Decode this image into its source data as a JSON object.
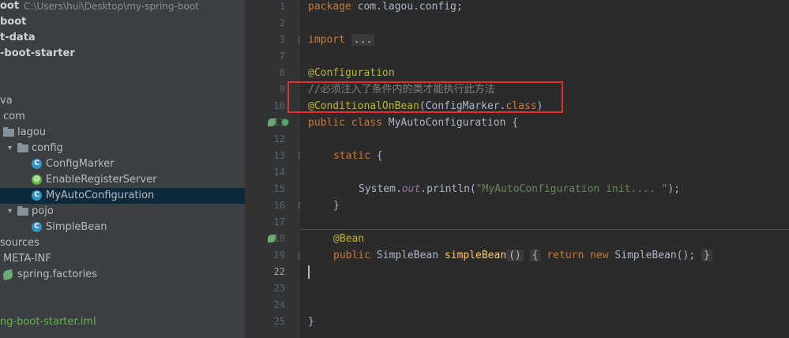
{
  "project_tree": [
    {
      "name": "tree-root-project",
      "label": "oot",
      "extra": "C:\\Users\\hui\\Desktop\\my-spring-boot",
      "style": "bold",
      "icon": "none"
    },
    {
      "name": "tree-module-boot",
      "label": "boot",
      "style": "bold",
      "icon": "none"
    },
    {
      "name": "tree-module-data",
      "label": "t-data",
      "style": "bold",
      "icon": "none"
    },
    {
      "name": "tree-module-starter",
      "label": "-boot-starter",
      "style": "bold",
      "icon": "none"
    },
    {
      "name": "tree-blank",
      "label": "",
      "style": "normal",
      "icon": "none"
    },
    {
      "name": "tree-folder-java",
      "label": "va",
      "style": "normal",
      "icon": "none"
    },
    {
      "name": "tree-package-com",
      "label": "com",
      "style": "normal",
      "icon": "none"
    },
    {
      "name": "tree-package-lagou",
      "label": "lagou",
      "style": "normal",
      "icon": "folder"
    },
    {
      "name": "tree-package-config",
      "label": "config",
      "style": "normal",
      "icon": "folder"
    },
    {
      "name": "tree-class-configmarker",
      "label": "ConfigMarker",
      "style": "normal",
      "icon": "class"
    },
    {
      "name": "tree-annotation-enableregisterserver",
      "label": "EnableRegisterServer",
      "style": "normal",
      "icon": "annotation"
    },
    {
      "name": "tree-class-myautoconfiguration",
      "label": "MyAutoConfiguration",
      "style": "normal",
      "icon": "class",
      "selected": true
    },
    {
      "name": "tree-package-pojo",
      "label": "pojo",
      "style": "normal",
      "icon": "folder"
    },
    {
      "name": "tree-class-simplebean",
      "label": "SimpleBean",
      "style": "normal",
      "icon": "class"
    },
    {
      "name": "tree-folder-resources",
      "label": "sources",
      "style": "normal",
      "icon": "none"
    },
    {
      "name": "tree-folder-meta-inf",
      "label": "META-INF",
      "style": "normal",
      "icon": "none"
    },
    {
      "name": "tree-file-spring-factories",
      "label": "spring.factories",
      "style": "normal",
      "icon": "spring"
    },
    {
      "name": "tree-blank2",
      "label": "",
      "style": "normal",
      "icon": "none"
    },
    {
      "name": "tree-blank3",
      "label": "",
      "style": "normal",
      "icon": "none"
    },
    {
      "name": "tree-file-iml",
      "label": "ng-boot-starter.iml",
      "style": "green",
      "icon": "none"
    }
  ],
  "line_numbers": [
    "1",
    "2",
    "3",
    "7",
    "8",
    "9",
    "10",
    "11",
    "12",
    "13",
    "14",
    "15",
    "16",
    "17",
    "18",
    "19",
    "22",
    "23",
    "24",
    "25"
  ],
  "code": {
    "l1_kw": "package",
    "l1_rest": " com.lagou.config;",
    "l3_kw": "import",
    "l3_fold": "...",
    "l8_anno": "@Configuration",
    "l9_comment": "//必须注入了条件内的类才能执行此方法",
    "l10_anno": "@ConditionalOnBean",
    "l10_open": "(ConfigMarker.",
    "l10_kw": "class",
    "l10_close": ")",
    "l11_kw": "public class",
    "l11_rest": " MyAutoConfiguration {",
    "l13_kw": "static",
    "l13_rest": " {",
    "l15_pre": "System.",
    "l15_field": "out",
    "l15_mid": ".println(",
    "l15_str": "\"MyAutoConfiguration init.... \"",
    "l15_end": ");",
    "l16_rest": "}",
    "l18_anno": "@Bean",
    "l19_kw": "public",
    "l19_type": " SimpleBean ",
    "l19_fn": "simpleBean",
    "l19_paren": "()",
    "l19_body_open": "{",
    "l19_return": "return new",
    "l19_body": " SimpleBean();",
    "l19_body_close": "}",
    "l25_rest": "}"
  }
}
